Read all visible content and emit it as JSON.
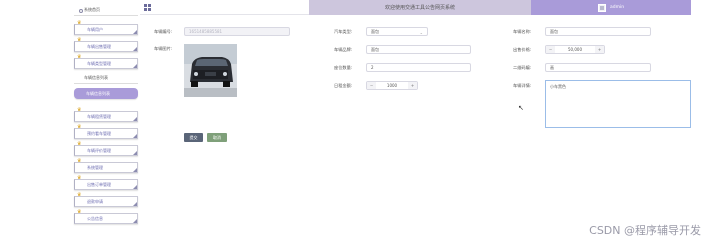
{
  "header": {
    "title": "欢迎使用交通工具公告网页系统",
    "username": "admin"
  },
  "sidebar": {
    "items": [
      {
        "label": "系统首页"
      },
      {
        "label": "车辆用户"
      },
      {
        "label": "车辆出售管理"
      },
      {
        "label": "车辆类型管理"
      },
      {
        "label": "车辆信息列表"
      },
      {
        "label": "车辆信息列表"
      },
      {
        "label": "车辆租赁管理"
      },
      {
        "label": "预约看车管理"
      },
      {
        "label": "车辆评价管理"
      },
      {
        "label": "系统管理"
      },
      {
        "label": "出售订单管理"
      },
      {
        "label": "退款申请"
      },
      {
        "label": "公告信息"
      }
    ]
  },
  "form": {
    "vehicle_number_label": "车辆编号:",
    "vehicle_number_value": "1651485885581",
    "vehicle_type_label": "汽车类型:",
    "vehicle_type_value": "面包",
    "vehicle_name_label": "车辆名称:",
    "vehicle_name_value": "面包",
    "vehicle_image_label": "车辆图片:",
    "vehicle_brand_label": "车辆品牌:",
    "vehicle_brand_value": "面包",
    "sale_price_label": "出售价格:",
    "sale_price_value": "50,000",
    "seat_count_label": "座位数量:",
    "seat_count_value": "2",
    "plate_label": "二维码编:",
    "plate_value": "画",
    "rent_price_label": "日租金额:",
    "rent_price_value": "1000",
    "detail_label": "车辆详情:",
    "detail_value": "小车黑色",
    "submit_label": "提交",
    "cancel_label": "取消"
  },
  "watermark": "CSDN @程序辅导开发"
}
